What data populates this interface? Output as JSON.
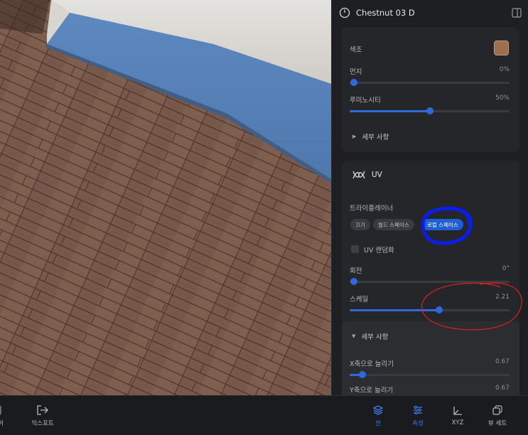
{
  "window": {
    "material_name": "Chestnut 03 D"
  },
  "section1": {
    "color_label": "색조",
    "swatch_color": "#9c6f4d",
    "dust": {
      "label": "먼지",
      "value_text": "0%",
      "value": 0
    },
    "luminosity": {
      "label": "루미노시티",
      "value_text": "50%",
      "value": 0.5
    },
    "details_label": "세부 사항"
  },
  "uv": {
    "title": "UV",
    "triplanar_label": "트라이플레이너",
    "triplanar_options": [
      "끄기",
      "월드 스페이스",
      "로컬 스페이스"
    ],
    "triplanar_selected": "로컬 스페이스",
    "randomize_label": "UV 랜덤화",
    "rotation": {
      "label": "회전",
      "value_text": "0°",
      "value": 0
    },
    "scale": {
      "label": "스케일",
      "value_text": "2.21",
      "value": 0.56
    },
    "details": {
      "label": "세부 사항",
      "stretch_x": {
        "label": "X축으로 늘리기",
        "value_text": "0.67",
        "value": 0.08
      },
      "stretch_y": {
        "label": "Y축으로 늘리기",
        "value_text": "0.67"
      }
    }
  },
  "toolbar": {
    "left_partial": "어",
    "export_label": "익스포트",
    "items": [
      {
        "label": "씬",
        "icon": "layers-icon",
        "active": true
      },
      {
        "label": "속성",
        "icon": "sliders-icon",
        "active": true
      },
      {
        "label": "XYZ",
        "icon": "axis-icon",
        "active": false
      },
      {
        "label": "뷰 세트",
        "icon": "view-set-icon",
        "active": false
      }
    ]
  },
  "annotation_colors": {
    "blue_circle": "#0a1ee8",
    "red_circle": "#e02020"
  }
}
